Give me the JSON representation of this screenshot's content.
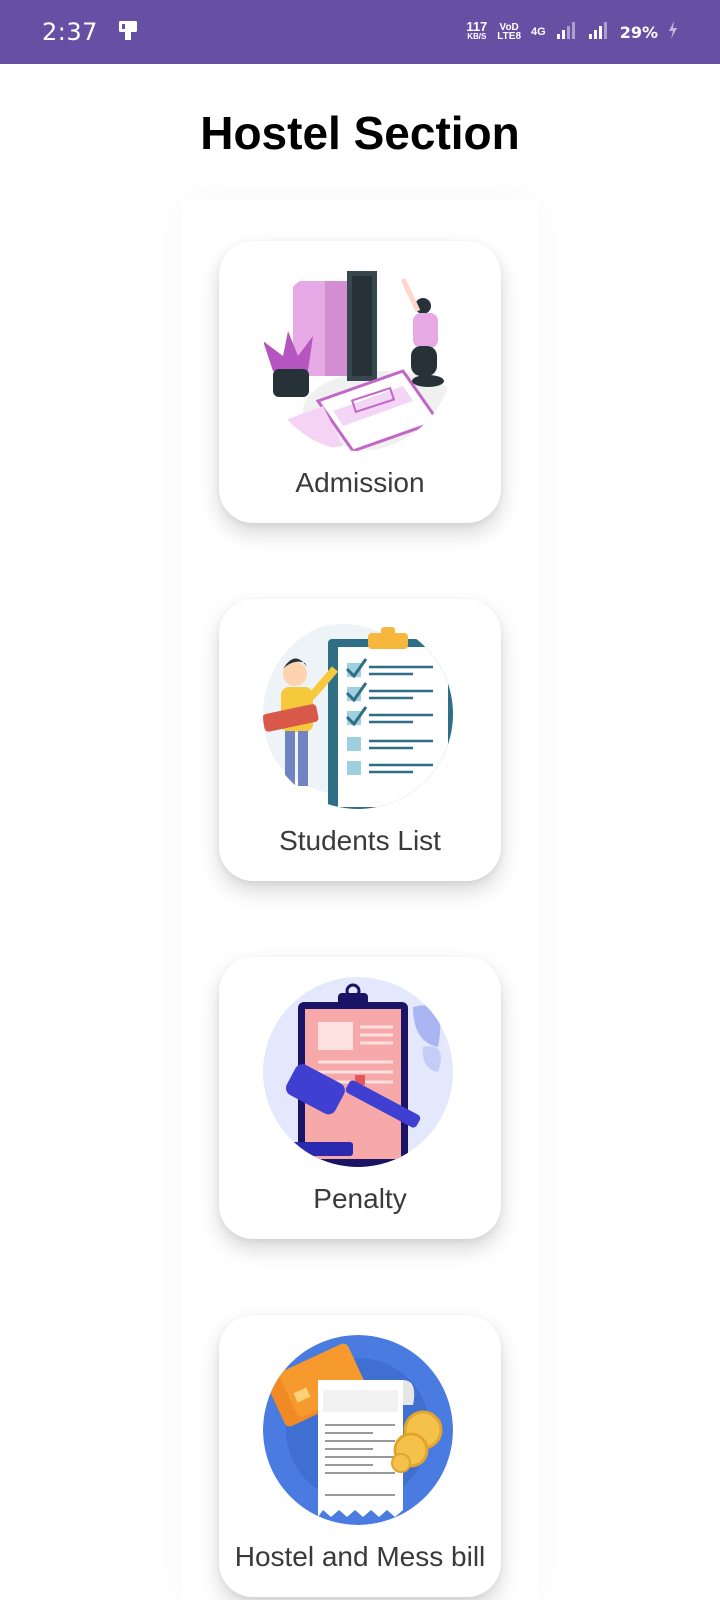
{
  "status_bar": {
    "time": "2:37",
    "net_speed_value": "117",
    "net_speed_unit": "KB/S",
    "volte_top": "VoD",
    "volte_bottom": "LTE8",
    "network_type": "4G",
    "battery_percent": "29%",
    "background_color": "#6750a4",
    "icons": [
      "notification-app-icon",
      "signal-strength-icon",
      "signal-strength-icon",
      "charging-icon"
    ]
  },
  "page": {
    "title": "Hostel Section"
  },
  "menu": [
    {
      "label": "Admission",
      "icon": "admission-illustration"
    },
    {
      "label": "Students List",
      "icon": "students-list-illustration"
    },
    {
      "label": "Penalty",
      "icon": "penalty-illustration"
    },
    {
      "label": "Hostel and Mess bill",
      "icon": "hostel-mess-bill-illustration"
    }
  ]
}
